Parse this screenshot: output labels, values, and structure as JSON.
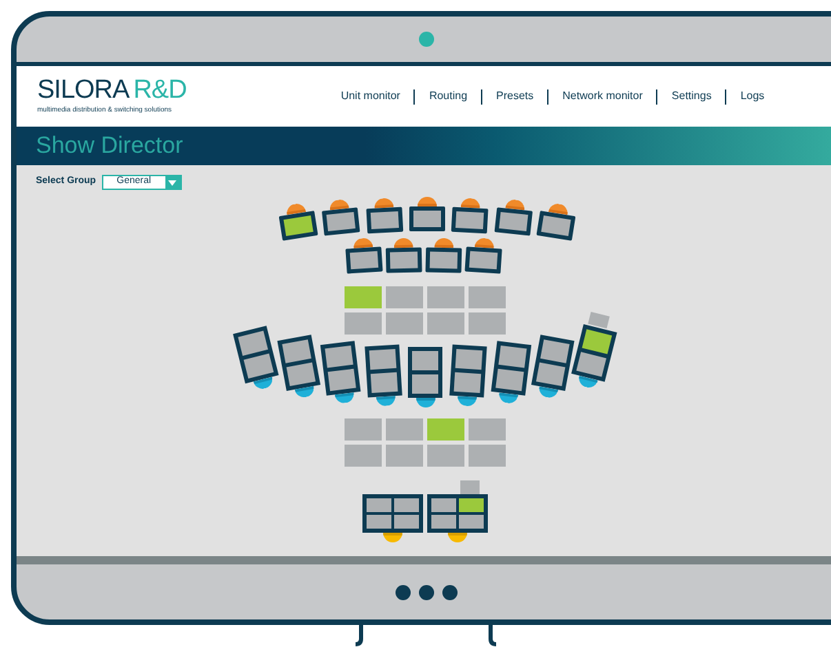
{
  "header": {
    "brand": "SILORA",
    "brand_accent": "R&D",
    "tagline": "multimedia distribution & switching solutions",
    "nav": [
      "Unit monitor",
      "Routing",
      "Presets",
      "Network monitor",
      "Settings",
      "Logs"
    ]
  },
  "page_title": "Show Director",
  "group_select": {
    "label": "Select Group",
    "value": "General"
  },
  "floor": {
    "front_row": [
      {
        "selected": true
      },
      {
        "selected": false
      },
      {
        "selected": false
      },
      {
        "selected": false
      },
      {
        "selected": false
      },
      {
        "selected": false
      },
      {
        "selected": false
      }
    ],
    "second_row": [
      {
        "selected": false
      },
      {
        "selected": false
      },
      {
        "selected": false
      },
      {
        "selected": false
      }
    ],
    "upper_wall": [
      {
        "selected": true
      },
      {
        "selected": false
      },
      {
        "selected": false
      },
      {
        "selected": false
      },
      {
        "selected": false
      },
      {
        "selected": false
      },
      {
        "selected": false
      },
      {
        "selected": false
      }
    ],
    "curved_row": [
      {
        "screens": [
          {
            "selected": false
          },
          {
            "selected": false
          }
        ]
      },
      {
        "screens": [
          {
            "selected": false
          },
          {
            "selected": false
          }
        ]
      },
      {
        "screens": [
          {
            "selected": false
          },
          {
            "selected": false
          }
        ]
      },
      {
        "screens": [
          {
            "selected": false
          },
          {
            "selected": false
          }
        ]
      },
      {
        "screens": [
          {
            "selected": false
          },
          {
            "selected": false
          }
        ]
      },
      {
        "screens": [
          {
            "selected": false
          },
          {
            "selected": false
          }
        ]
      },
      {
        "screens": [
          {
            "selected": false
          },
          {
            "selected": false
          }
        ]
      },
      {
        "screens": [
          {
            "selected": false
          },
          {
            "selected": false
          }
        ]
      },
      {
        "screens": [
          {
            "selected": true
          },
          {
            "selected": false
          }
        ]
      }
    ],
    "lower_wall": [
      {
        "selected": false
      },
      {
        "selected": false
      },
      {
        "selected": true
      },
      {
        "selected": false
      },
      {
        "selected": false
      },
      {
        "selected": false
      },
      {
        "selected": false
      },
      {
        "selected": false
      }
    ],
    "desks": [
      {
        "screens": [
          {
            "selected": false
          },
          {
            "selected": false
          },
          {
            "selected": false
          },
          {
            "selected": false
          }
        ]
      },
      {
        "screens": [
          {
            "selected": false
          },
          {
            "selected": true
          },
          {
            "selected": false
          },
          {
            "selected": false
          }
        ]
      }
    ]
  }
}
